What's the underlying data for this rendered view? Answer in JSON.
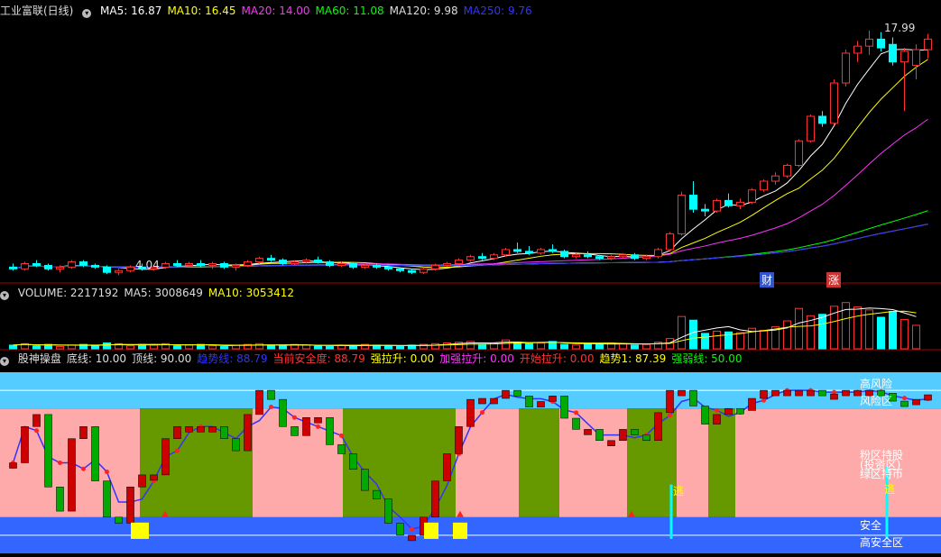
{
  "main_header": {
    "title": "工业富联(日线)",
    "items": [
      {
        "label": "MA5: 16.87",
        "color": "#ffffff"
      },
      {
        "label": "MA10: 16.45",
        "color": "#ffff00"
      },
      {
        "label": "MA20: 14.00",
        "color": "#ff33ff"
      },
      {
        "label": "MA60: 11.08",
        "color": "#00ff00"
      },
      {
        "label": "MA120: 9.98",
        "color": "#dddddd"
      },
      {
        "label": "MA250: 9.76",
        "color": "#3333ff"
      }
    ]
  },
  "volume_header": {
    "items": [
      {
        "label": "VOLUME: 2217192",
        "color": "#dddddd"
      },
      {
        "label": "MA5: 3008649",
        "color": "#dddddd"
      },
      {
        "label": "MA10: 3053412",
        "color": "#ffff00"
      }
    ]
  },
  "indicator_header": {
    "items": [
      {
        "label": "股神操盘",
        "color": "#dddddd"
      },
      {
        "label": "底线: 10.00",
        "color": "#dddddd"
      },
      {
        "label": "顶线: 90.00",
        "color": "#dddddd"
      },
      {
        "label": "趋势线: 88.79",
        "color": "#3333ff"
      },
      {
        "label": "当前安全度: 88.79",
        "color": "#ff3333"
      },
      {
        "label": "强拉升: 0.00",
        "color": "#ffff00"
      },
      {
        "label": "加强拉升: 0.00",
        "color": "#ff33ff"
      },
      {
        "label": "开始拉升: 0.00",
        "color": "#ff3333"
      },
      {
        "label": "趋势1: 87.39",
        "color": "#ffff00"
      },
      {
        "label": "强弱线: 50.00",
        "color": "#00ff00"
      }
    ]
  },
  "price_labels": {
    "high": "17.99",
    "low": "4.04"
  },
  "event_labels": {
    "cai": "财",
    "zhang": "涨"
  },
  "zone_labels": {
    "high_risk": "高风险",
    "risk": "风险区",
    "pink_sell": "粉区持股",
    "invest": "(投资区)",
    "green_wait": "绿区持币",
    "escape": "逃",
    "safe": "安全",
    "high_safe": "高安全区"
  },
  "colors": {
    "up": "#ff3232",
    "down": "#00ffff",
    "pink": "#ffaaaa",
    "olive": "#669900",
    "lightblue": "#55ccff",
    "blue": "#3366ff",
    "yellow": "#ffff00"
  },
  "chart_data": {
    "type": "candlestick",
    "candles": [
      {
        "o": 4.5,
        "h": 4.7,
        "l": 4.3,
        "c": 4.4
      },
      {
        "o": 4.4,
        "h": 4.8,
        "l": 4.3,
        "c": 4.7
      },
      {
        "o": 4.7,
        "h": 4.9,
        "l": 4.5,
        "c": 4.6
      },
      {
        "o": 4.6,
        "h": 4.7,
        "l": 4.3,
        "c": 4.4
      },
      {
        "o": 4.4,
        "h": 4.6,
        "l": 4.2,
        "c": 4.5
      },
      {
        "o": 4.5,
        "h": 4.9,
        "l": 4.4,
        "c": 4.8
      },
      {
        "o": 4.8,
        "h": 4.9,
        "l": 4.5,
        "c": 4.6
      },
      {
        "o": 4.6,
        "h": 4.7,
        "l": 4.4,
        "c": 4.5
      },
      {
        "o": 4.5,
        "h": 4.6,
        "l": 4.1,
        "c": 4.2
      },
      {
        "o": 4.2,
        "h": 4.4,
        "l": 4.04,
        "c": 4.3
      },
      {
        "o": 4.3,
        "h": 4.6,
        "l": 4.2,
        "c": 4.5
      },
      {
        "o": 4.5,
        "h": 4.7,
        "l": 4.3,
        "c": 4.4
      },
      {
        "o": 4.4,
        "h": 4.6,
        "l": 4.3,
        "c": 4.5
      },
      {
        "o": 4.5,
        "h": 4.8,
        "l": 4.4,
        "c": 4.7
      },
      {
        "o": 4.7,
        "h": 4.9,
        "l": 4.5,
        "c": 4.6
      },
      {
        "o": 4.6,
        "h": 4.8,
        "l": 4.5,
        "c": 4.7
      },
      {
        "o": 4.7,
        "h": 4.9,
        "l": 4.5,
        "c": 4.6
      },
      {
        "o": 4.6,
        "h": 4.8,
        "l": 4.4,
        "c": 4.7
      },
      {
        "o": 4.7,
        "h": 4.8,
        "l": 4.4,
        "c": 4.5
      },
      {
        "o": 4.5,
        "h": 4.7,
        "l": 4.3,
        "c": 4.6
      },
      {
        "o": 4.6,
        "h": 4.9,
        "l": 4.5,
        "c": 4.8
      },
      {
        "o": 4.8,
        "h": 5.1,
        "l": 4.7,
        "c": 5.0
      },
      {
        "o": 5.0,
        "h": 5.2,
        "l": 4.8,
        "c": 4.9
      },
      {
        "o": 4.9,
        "h": 5.0,
        "l": 4.6,
        "c": 4.7
      },
      {
        "o": 4.7,
        "h": 4.9,
        "l": 4.6,
        "c": 4.8
      },
      {
        "o": 4.8,
        "h": 5.0,
        "l": 4.7,
        "c": 4.9
      },
      {
        "o": 4.9,
        "h": 5.1,
        "l": 4.7,
        "c": 4.8
      },
      {
        "o": 4.8,
        "h": 4.9,
        "l": 4.5,
        "c": 4.6
      },
      {
        "o": 4.6,
        "h": 4.8,
        "l": 4.5,
        "c": 4.7
      },
      {
        "o": 4.7,
        "h": 4.8,
        "l": 4.4,
        "c": 4.5
      },
      {
        "o": 4.5,
        "h": 4.7,
        "l": 4.4,
        "c": 4.6
      },
      {
        "o": 4.6,
        "h": 4.7,
        "l": 4.4,
        "c": 4.5
      },
      {
        "o": 4.5,
        "h": 4.6,
        "l": 4.3,
        "c": 4.4
      },
      {
        "o": 4.4,
        "h": 4.5,
        "l": 4.2,
        "c": 4.3
      },
      {
        "o": 4.3,
        "h": 4.4,
        "l": 4.1,
        "c": 4.2
      },
      {
        "o": 4.2,
        "h": 4.5,
        "l": 4.1,
        "c": 4.4
      },
      {
        "o": 4.4,
        "h": 4.7,
        "l": 4.3,
        "c": 4.6
      },
      {
        "o": 4.6,
        "h": 4.8,
        "l": 4.5,
        "c": 4.7
      },
      {
        "o": 4.7,
        "h": 5.0,
        "l": 4.6,
        "c": 4.9
      },
      {
        "o": 4.9,
        "h": 5.2,
        "l": 4.8,
        "c": 5.1
      },
      {
        "o": 5.1,
        "h": 5.3,
        "l": 4.9,
        "c": 5.0
      },
      {
        "o": 5.0,
        "h": 5.3,
        "l": 4.9,
        "c": 5.2
      },
      {
        "o": 5.2,
        "h": 5.6,
        "l": 5.1,
        "c": 5.5
      },
      {
        "o": 5.5,
        "h": 5.9,
        "l": 5.3,
        "c": 5.4
      },
      {
        "o": 5.4,
        "h": 5.7,
        "l": 5.2,
        "c": 5.3
      },
      {
        "o": 5.3,
        "h": 5.6,
        "l": 5.2,
        "c": 5.5
      },
      {
        "o": 5.5,
        "h": 5.8,
        "l": 5.3,
        "c": 5.4
      },
      {
        "o": 5.4,
        "h": 5.5,
        "l": 5.0,
        "c": 5.1
      },
      {
        "o": 5.1,
        "h": 5.3,
        "l": 5.0,
        "c": 5.2
      },
      {
        "o": 5.2,
        "h": 5.4,
        "l": 5.0,
        "c": 5.1
      },
      {
        "o": 5.1,
        "h": 5.2,
        "l": 4.9,
        "c": 5.0
      },
      {
        "o": 5.0,
        "h": 5.2,
        "l": 4.9,
        "c": 5.1
      },
      {
        "o": 5.1,
        "h": 5.3,
        "l": 5.0,
        "c": 5.2
      },
      {
        "o": 5.2,
        "h": 5.3,
        "l": 4.9,
        "c": 5.0
      },
      {
        "o": 5.0,
        "h": 5.2,
        "l": 4.9,
        "c": 5.1
      },
      {
        "o": 5.1,
        "h": 5.6,
        "l": 5.0,
        "c": 5.5
      },
      {
        "o": 5.5,
        "h": 6.5,
        "l": 5.4,
        "c": 6.4
      },
      {
        "o": 6.4,
        "h": 8.8,
        "l": 6.3,
        "c": 8.6
      },
      {
        "o": 8.6,
        "h": 9.4,
        "l": 7.6,
        "c": 7.8
      },
      {
        "o": 7.8,
        "h": 8.1,
        "l": 7.4,
        "c": 7.7
      },
      {
        "o": 7.7,
        "h": 8.4,
        "l": 7.6,
        "c": 8.3
      },
      {
        "o": 8.3,
        "h": 8.7,
        "l": 7.9,
        "c": 8.0
      },
      {
        "o": 8.0,
        "h": 8.4,
        "l": 7.8,
        "c": 8.2
      },
      {
        "o": 8.2,
        "h": 9.0,
        "l": 8.1,
        "c": 8.9
      },
      {
        "o": 8.9,
        "h": 9.5,
        "l": 8.8,
        "c": 9.4
      },
      {
        "o": 9.4,
        "h": 9.9,
        "l": 9.2,
        "c": 9.7
      },
      {
        "o": 9.7,
        "h": 10.4,
        "l": 9.6,
        "c": 10.3
      },
      {
        "o": 10.3,
        "h": 11.8,
        "l": 10.2,
        "c": 11.7
      },
      {
        "o": 11.7,
        "h": 13.2,
        "l": 11.6,
        "c": 13.1
      },
      {
        "o": 13.1,
        "h": 13.4,
        "l": 12.5,
        "c": 12.7
      },
      {
        "o": 12.7,
        "h": 15.2,
        "l": 12.6,
        "c": 15.0
      },
      {
        "o": 15.0,
        "h": 16.9,
        "l": 14.8,
        "c": 16.7
      },
      {
        "o": 16.7,
        "h": 17.4,
        "l": 16.2,
        "c": 17.1
      },
      {
        "o": 17.1,
        "h": 17.99,
        "l": 16.6,
        "c": 17.5
      },
      {
        "o": 17.5,
        "h": 17.9,
        "l": 16.8,
        "c": 17.0
      },
      {
        "o": 17.2,
        "h": 17.6,
        "l": 16.0,
        "c": 16.2
      },
      {
        "o": 16.2,
        "h": 17.0,
        "l": 13.4,
        "c": 16.8
      },
      {
        "o": 16.0,
        "h": 17.2,
        "l": 15.2,
        "c": 16.9
      },
      {
        "o": 16.9,
        "h": 17.8,
        "l": 16.4,
        "c": 17.5
      }
    ],
    "volume": [
      5,
      7,
      4,
      6,
      3,
      5,
      6,
      4,
      8,
      7,
      4,
      6,
      5,
      7,
      4,
      5,
      6,
      4,
      3,
      5,
      6,
      7,
      5,
      4,
      6,
      5,
      4,
      3,
      5,
      4,
      6,
      5,
      4,
      3,
      5,
      6,
      7,
      8,
      9,
      10,
      6,
      8,
      12,
      9,
      7,
      8,
      10,
      6,
      5,
      7,
      6,
      8,
      7,
      5,
      6,
      9,
      14,
      44,
      39,
      21,
      24,
      23,
      22,
      28,
      25,
      30,
      38,
      55,
      45,
      47,
      58,
      63,
      57,
      53,
      43,
      51,
      40,
      32
    ],
    "pane_scale": {
      "price": [
        3.8,
        18.6
      ],
      "volume": [
        0,
        70
      ],
      "indicator": [
        0,
        100
      ]
    }
  }
}
